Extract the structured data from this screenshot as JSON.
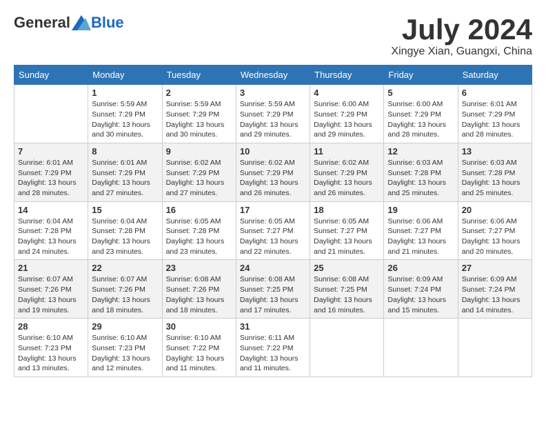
{
  "header": {
    "logo": {
      "general": "General",
      "blue": "Blue"
    },
    "month": "July 2024",
    "location": "Xingye Xian, Guangxi, China"
  },
  "weekdays": [
    "Sunday",
    "Monday",
    "Tuesday",
    "Wednesday",
    "Thursday",
    "Friday",
    "Saturday"
  ],
  "weeks": [
    [
      {
        "day": "",
        "info": ""
      },
      {
        "day": "1",
        "info": "Sunrise: 5:59 AM\nSunset: 7:29 PM\nDaylight: 13 hours\nand 30 minutes."
      },
      {
        "day": "2",
        "info": "Sunrise: 5:59 AM\nSunset: 7:29 PM\nDaylight: 13 hours\nand 30 minutes."
      },
      {
        "day": "3",
        "info": "Sunrise: 5:59 AM\nSunset: 7:29 PM\nDaylight: 13 hours\nand 29 minutes."
      },
      {
        "day": "4",
        "info": "Sunrise: 6:00 AM\nSunset: 7:29 PM\nDaylight: 13 hours\nand 29 minutes."
      },
      {
        "day": "5",
        "info": "Sunrise: 6:00 AM\nSunset: 7:29 PM\nDaylight: 13 hours\nand 28 minutes."
      },
      {
        "day": "6",
        "info": "Sunrise: 6:01 AM\nSunset: 7:29 PM\nDaylight: 13 hours\nand 28 minutes."
      }
    ],
    [
      {
        "day": "7",
        "info": "Sunrise: 6:01 AM\nSunset: 7:29 PM\nDaylight: 13 hours\nand 28 minutes."
      },
      {
        "day": "8",
        "info": "Sunrise: 6:01 AM\nSunset: 7:29 PM\nDaylight: 13 hours\nand 27 minutes."
      },
      {
        "day": "9",
        "info": "Sunrise: 6:02 AM\nSunset: 7:29 PM\nDaylight: 13 hours\nand 27 minutes."
      },
      {
        "day": "10",
        "info": "Sunrise: 6:02 AM\nSunset: 7:29 PM\nDaylight: 13 hours\nand 26 minutes."
      },
      {
        "day": "11",
        "info": "Sunrise: 6:02 AM\nSunset: 7:29 PM\nDaylight: 13 hours\nand 26 minutes."
      },
      {
        "day": "12",
        "info": "Sunrise: 6:03 AM\nSunset: 7:28 PM\nDaylight: 13 hours\nand 25 minutes."
      },
      {
        "day": "13",
        "info": "Sunrise: 6:03 AM\nSunset: 7:28 PM\nDaylight: 13 hours\nand 25 minutes."
      }
    ],
    [
      {
        "day": "14",
        "info": "Sunrise: 6:04 AM\nSunset: 7:28 PM\nDaylight: 13 hours\nand 24 minutes."
      },
      {
        "day": "15",
        "info": "Sunrise: 6:04 AM\nSunset: 7:28 PM\nDaylight: 13 hours\nand 23 minutes."
      },
      {
        "day": "16",
        "info": "Sunrise: 6:05 AM\nSunset: 7:28 PM\nDaylight: 13 hours\nand 23 minutes."
      },
      {
        "day": "17",
        "info": "Sunrise: 6:05 AM\nSunset: 7:27 PM\nDaylight: 13 hours\nand 22 minutes."
      },
      {
        "day": "18",
        "info": "Sunrise: 6:05 AM\nSunset: 7:27 PM\nDaylight: 13 hours\nand 21 minutes."
      },
      {
        "day": "19",
        "info": "Sunrise: 6:06 AM\nSunset: 7:27 PM\nDaylight: 13 hours\nand 21 minutes."
      },
      {
        "day": "20",
        "info": "Sunrise: 6:06 AM\nSunset: 7:27 PM\nDaylight: 13 hours\nand 20 minutes."
      }
    ],
    [
      {
        "day": "21",
        "info": "Sunrise: 6:07 AM\nSunset: 7:26 PM\nDaylight: 13 hours\nand 19 minutes."
      },
      {
        "day": "22",
        "info": "Sunrise: 6:07 AM\nSunset: 7:26 PM\nDaylight: 13 hours\nand 18 minutes."
      },
      {
        "day": "23",
        "info": "Sunrise: 6:08 AM\nSunset: 7:26 PM\nDaylight: 13 hours\nand 18 minutes."
      },
      {
        "day": "24",
        "info": "Sunrise: 6:08 AM\nSunset: 7:25 PM\nDaylight: 13 hours\nand 17 minutes."
      },
      {
        "day": "25",
        "info": "Sunrise: 6:08 AM\nSunset: 7:25 PM\nDaylight: 13 hours\nand 16 minutes."
      },
      {
        "day": "26",
        "info": "Sunrise: 6:09 AM\nSunset: 7:24 PM\nDaylight: 13 hours\nand 15 minutes."
      },
      {
        "day": "27",
        "info": "Sunrise: 6:09 AM\nSunset: 7:24 PM\nDaylight: 13 hours\nand 14 minutes."
      }
    ],
    [
      {
        "day": "28",
        "info": "Sunrise: 6:10 AM\nSunset: 7:23 PM\nDaylight: 13 hours\nand 13 minutes."
      },
      {
        "day": "29",
        "info": "Sunrise: 6:10 AM\nSunset: 7:23 PM\nDaylight: 13 hours\nand 12 minutes."
      },
      {
        "day": "30",
        "info": "Sunrise: 6:10 AM\nSunset: 7:22 PM\nDaylight: 13 hours\nand 11 minutes."
      },
      {
        "day": "31",
        "info": "Sunrise: 6:11 AM\nSunset: 7:22 PM\nDaylight: 13 hours\nand 11 minutes."
      },
      {
        "day": "",
        "info": ""
      },
      {
        "day": "",
        "info": ""
      },
      {
        "day": "",
        "info": ""
      }
    ]
  ]
}
